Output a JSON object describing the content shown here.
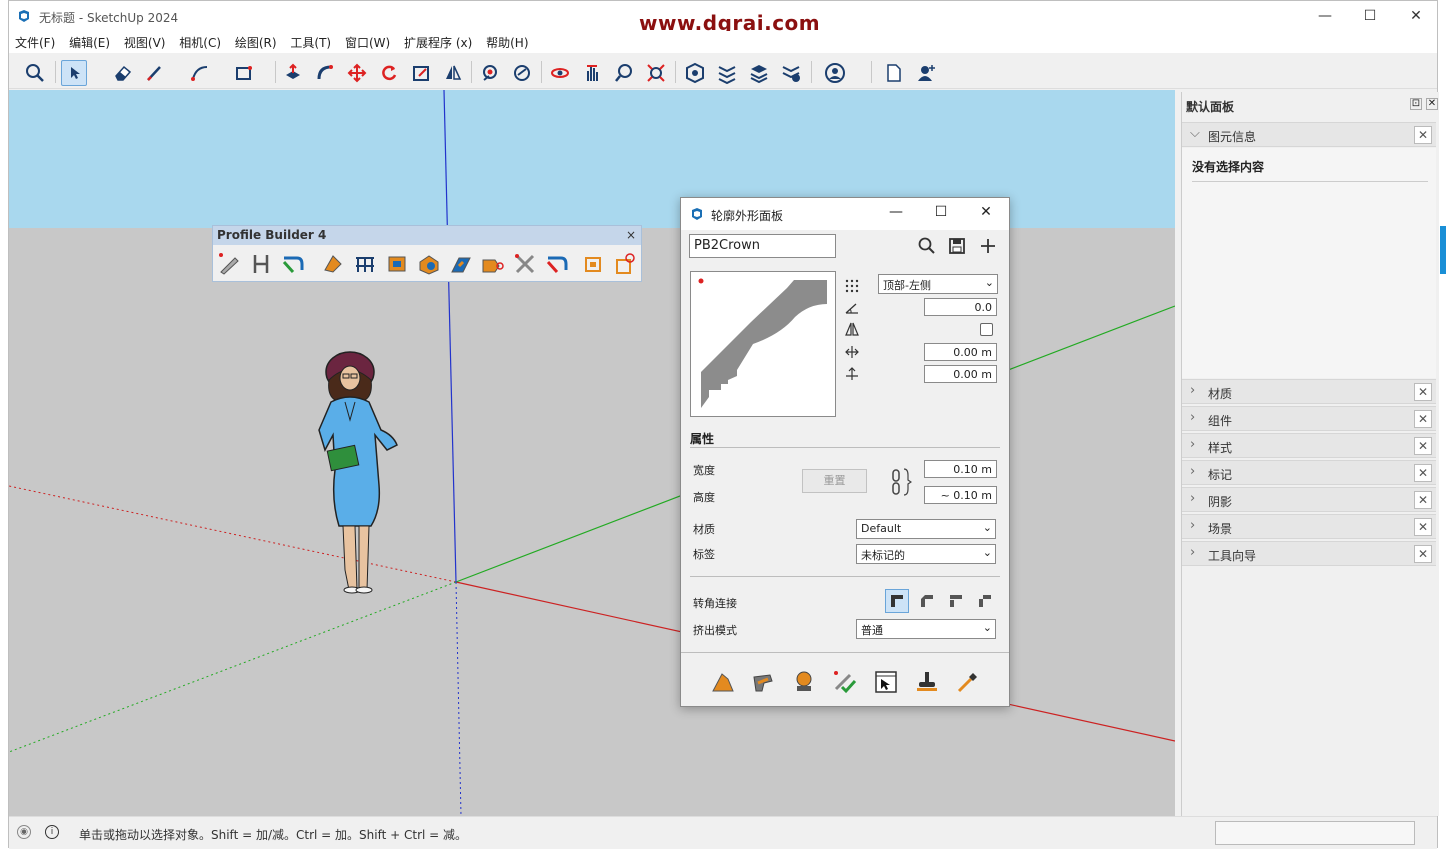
{
  "window": {
    "title": "无标题 - SketchUp 2024",
    "watermark": "www.dgrai.com"
  },
  "window_controls": {
    "minimize": "—",
    "maximize": "☐",
    "close": "✕"
  },
  "menu": [
    "文件(F)",
    "编辑(E)",
    "视图(V)",
    "相机(C)",
    "绘图(R)",
    "工具(T)",
    "窗口(W)",
    "扩展程序 (x)",
    "帮助(H)"
  ],
  "toolbar_icons": [
    "search-icon",
    "select-icon",
    "eraser-icon",
    "pencil-icon",
    "arc-icon",
    "rectangle-icon",
    "push-pull-icon",
    "follow-me-icon",
    "move-icon",
    "rotate-icon",
    "scale-icon",
    "flip-icon",
    "tape-icon",
    "paint-icon",
    "orbit-icon",
    "pan-icon",
    "zoom-icon",
    "zoom-extents-icon",
    "warehouse-icon",
    "extension-warehouse-icon",
    "layout-icon",
    "extension-manager-icon",
    "account-icon",
    "new-file-icon",
    "add-user-icon"
  ],
  "profile_builder": {
    "title": "Profile Builder 4",
    "close": "×",
    "tools": [
      "profile-member-icon",
      "profile-path-icon",
      "profile-follow-icon",
      "profile-paint-icon",
      "profile-array-icon",
      "profile-box-icon",
      "profile-solid-icon",
      "profile-extrude-icon",
      "profile-cut-icon",
      "profile-intersect-icon",
      "profile-smart-icon",
      "profile-frame-icon",
      "profile-delete-icon"
    ]
  },
  "dialog": {
    "title": "轮廓外形面板",
    "name_value": "PB2Crown",
    "controls": {
      "minimize": "—",
      "maximize": "☐",
      "close": "✕"
    },
    "anchor_select": "顶部-左侧",
    "rotation_value": "0.0",
    "offset_x_value": "0.00 m",
    "offset_y_value": "0.00 m",
    "properties_header": "属性",
    "width_label": "宽度",
    "height_label": "高度",
    "reset_label": "重置",
    "width_value": "0.10 m",
    "height_value": "~ 0.10 m",
    "material_label": "材质",
    "material_value": "Default",
    "tag_label": "标签",
    "tag_value": "未标记的",
    "corner_label": "转角连接",
    "extrude_label": "挤出模式",
    "extrude_value": "普通"
  },
  "tray": {
    "title": "默认面板",
    "entity_info": "图元信息",
    "no_selection": "没有选择内容",
    "panels": [
      "材质",
      "组件",
      "样式",
      "标记",
      "阴影",
      "场景",
      "工具向导"
    ]
  },
  "status": {
    "message": "单击或拖动以选择对象。Shift = 加/减。Ctrl = 加。Shift + Ctrl = 减。"
  },
  "colors": {
    "sky": "#a9d8ee",
    "ground": "#c8c8c8",
    "x_axis": "#cc2222",
    "y_axis": "#22aa22",
    "z_axis": "#2233cc",
    "dress": "#5aaee8"
  }
}
